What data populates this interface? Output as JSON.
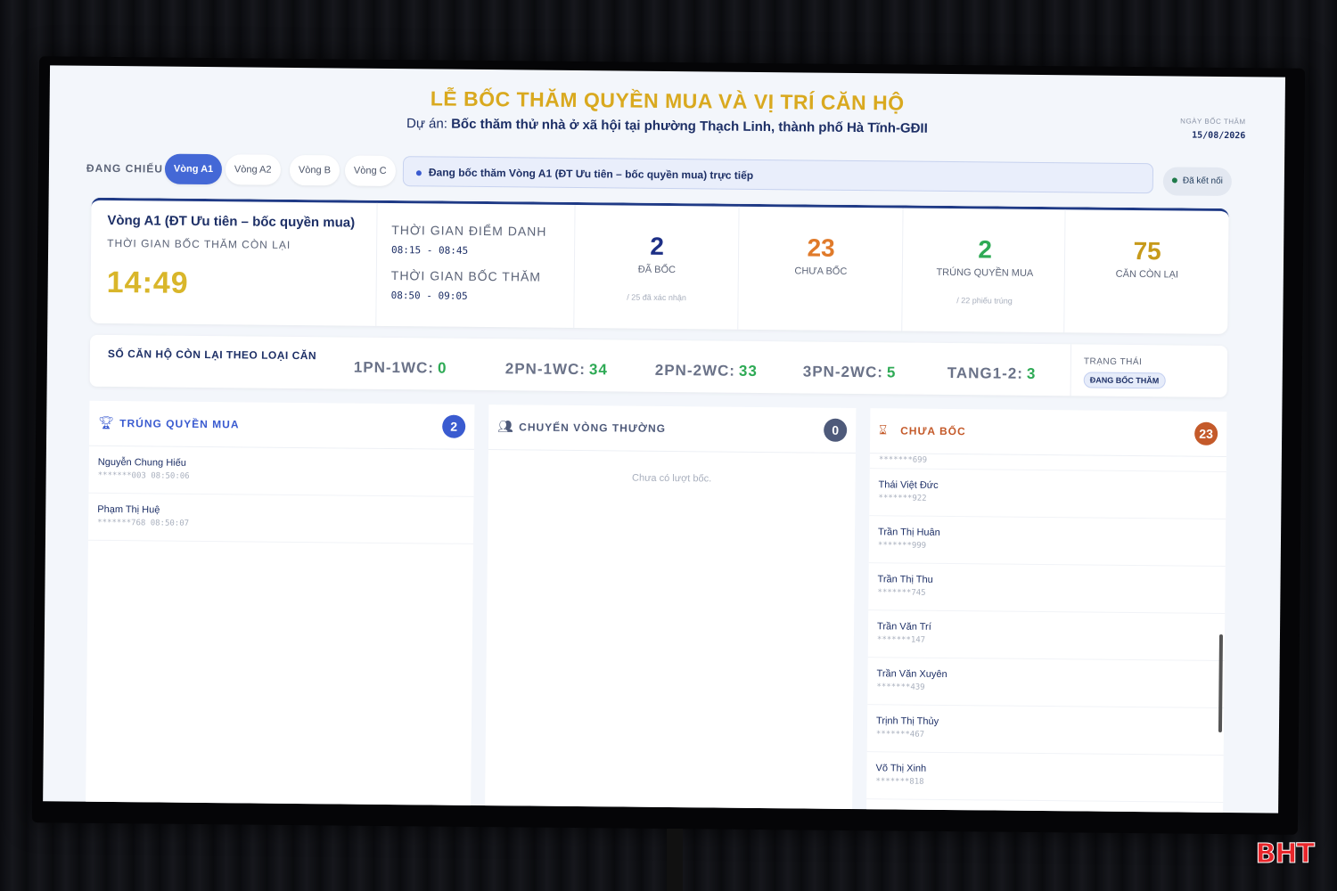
{
  "header": {
    "title": "LỄ BỐC THĂM QUYỀN MUA VÀ VỊ TRÍ CĂN HỘ",
    "project_label": "Dự án:",
    "project_name": "Bốc thăm thử nhà ở xã hội tại phường Thạch Linh, thành phố Hà Tĩnh-GĐII",
    "date_label": "NGÀY BỐC THĂM",
    "date_value": "15/08/2026"
  },
  "round_bar": {
    "now_showing": "ĐANG CHIẾU",
    "tabs": [
      {
        "label": "Vòng A1",
        "active": true
      },
      {
        "label": "Vòng A2",
        "active": false
      },
      {
        "label": "Vòng B",
        "active": false
      },
      {
        "label": "Vòng C",
        "active": false
      }
    ],
    "live_text": "Đang bốc thăm Vòng A1 (ĐT Ưu tiên – bốc quyền mua) trực tiếp",
    "connection": "Đã kết nối"
  },
  "status": {
    "round_name": "Vòng A1 (ĐT Ưu tiên – bốc quyền mua)",
    "remaining_label": "THỜI GIAN BỐC THĂM CÒN LẠI",
    "timer": "14:49",
    "checkin_label": "THỜI GIAN ĐIỂM DANH",
    "checkin_time": "08:15 - 08:45",
    "draw_label": "THỜI GIAN BỐC THĂM",
    "draw_time": "08:50 - 09:05",
    "stats": [
      {
        "value": "2",
        "label": "ĐÃ BỐC",
        "sub": "/ 25 đã xác nhận",
        "color": "#1d2f86"
      },
      {
        "value": "23",
        "label": "CHƯA BỐC",
        "sub": "",
        "color": "#e07a2a"
      },
      {
        "value": "2",
        "label": "TRÚNG QUYỀN MUA",
        "sub": "/ 22 phiếu trúng",
        "color": "#2eaa55"
      },
      {
        "value": "75",
        "label": "CĂN CÒN LẠI",
        "sub": "",
        "color": "#c79a1a"
      }
    ]
  },
  "apartment_types": {
    "label": "SỐ CĂN HỘ CÒN LẠI THEO LOẠI CĂN",
    "items": [
      {
        "name": "1PN-1WC:",
        "count": "0"
      },
      {
        "name": "2PN-1WC:",
        "count": "34"
      },
      {
        "name": "2PN-2WC:",
        "count": "33"
      },
      {
        "name": "3PN-2WC:",
        "count": "5"
      },
      {
        "name": "TANG1-2:",
        "count": "3"
      }
    ],
    "state_label": "TRẠNG THÁI",
    "state_value": "ĐANG BỐC THĂM"
  },
  "winners": {
    "title": "TRÚNG QUYỀN MUA",
    "count": "2",
    "color": "#3a5bd0",
    "items": [
      {
        "name": "Nguyễn Chung Hiếu",
        "meta": "*******003  08:50:06"
      },
      {
        "name": "Phạm Thị Huệ",
        "meta": "*******768  08:50:07"
      }
    ]
  },
  "regular": {
    "title": "CHUYỂN VÒNG THƯỜNG",
    "count": "0",
    "color": "#4e5a7a",
    "empty": "Chưa có lượt bốc."
  },
  "pending": {
    "title": "CHƯA BỐC",
    "count": "23",
    "color": "#c45a2a",
    "partial_top": "*******699",
    "items": [
      {
        "name": "Thái Việt Đức",
        "meta": "*******922"
      },
      {
        "name": "Trần Thị Huân",
        "meta": "*******999"
      },
      {
        "name": "Trần Thị Thu",
        "meta": "*******745"
      },
      {
        "name": "Trần Văn Trí",
        "meta": "*******147"
      },
      {
        "name": "Trần Văn Xuyên",
        "meta": "*******439"
      },
      {
        "name": "Trịnh Thị Thủy",
        "meta": "*******467"
      },
      {
        "name": "Võ Thị Xinh",
        "meta": "*******818"
      }
    ]
  },
  "watermark": "BHT"
}
